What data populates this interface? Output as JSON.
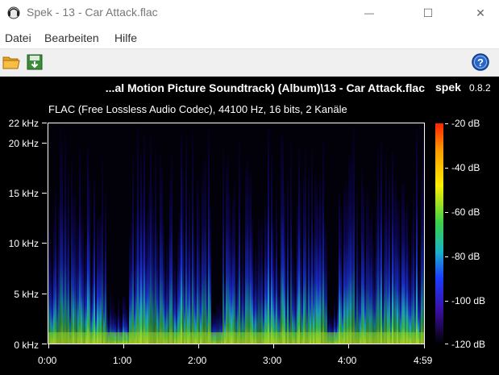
{
  "window": {
    "title": "Spek - 13 - Car Attack.flac",
    "minimize_glyph": "—",
    "maximize_glyph": "☐",
    "close_glyph": "✕"
  },
  "menu": [
    "Datei",
    "Bearbeiten",
    "Hilfe"
  ],
  "toolbar": {
    "open_icon": "folder-icon",
    "save_icon": "save-icon",
    "help_icon": "help-icon",
    "help_glyph": "?"
  },
  "viewer": {
    "file_title": "...al Motion Picture Soundtrack) (Album)\\13 - Car Attack.flac",
    "brand": "spek",
    "version": "0.8.2",
    "info": "FLAC (Free Lossless Audio Codec), 44100 Hz, 16 bits, 2 Kanäle",
    "freq_labels": [
      "22 kHz",
      "20 kHz",
      "15 kHz",
      "10 kHz",
      "5 kHz",
      "0 kHz"
    ],
    "time_labels": [
      "0:00",
      "1:00",
      "2:00",
      "3:00",
      "4:00",
      "4:59"
    ],
    "db_labels": [
      "-20 dB",
      "-40 dB",
      "-60 dB",
      "-80 dB",
      "-100 dB",
      "-120 dB"
    ]
  }
}
